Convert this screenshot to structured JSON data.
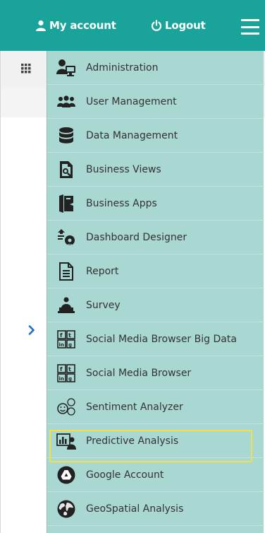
{
  "header": {
    "my_account_label": "My account",
    "logout_label": "Logout"
  },
  "menu": {
    "items": [
      {
        "label": "Administration",
        "icon": "admin-monitor-icon"
      },
      {
        "label": "User Management",
        "icon": "users-group-icon"
      },
      {
        "label": "Data Management",
        "icon": "database-icon"
      },
      {
        "label": "Business Views",
        "icon": "document-search-icon"
      },
      {
        "label": "Business Apps",
        "icon": "book-icon"
      },
      {
        "label": "Dashboard Designer",
        "icon": "dashboard-designer-icon"
      },
      {
        "label": "Report",
        "icon": "report-document-icon"
      },
      {
        "label": "Survey",
        "icon": "survey-person-icon"
      },
      {
        "label": "Social Media Browser Big Data",
        "icon": "social-media-grid-icon"
      },
      {
        "label": "Social Media Browser",
        "icon": "social-media-grid-icon"
      },
      {
        "label": "Sentiment Analyzer",
        "icon": "smiley-faces-icon"
      },
      {
        "label": "Predictive Analysis",
        "icon": "chart-person-icon",
        "highlighted": true
      },
      {
        "label": "Google Account",
        "icon": "google-drive-icon"
      },
      {
        "label": "GeoSpatial Analysis",
        "icon": "globe-icon"
      }
    ]
  },
  "colors": {
    "header": "#1aa39a",
    "menu_bg": "#a9d7d2",
    "highlight": "#f2e04a",
    "chevron": "#1a6fc4"
  }
}
